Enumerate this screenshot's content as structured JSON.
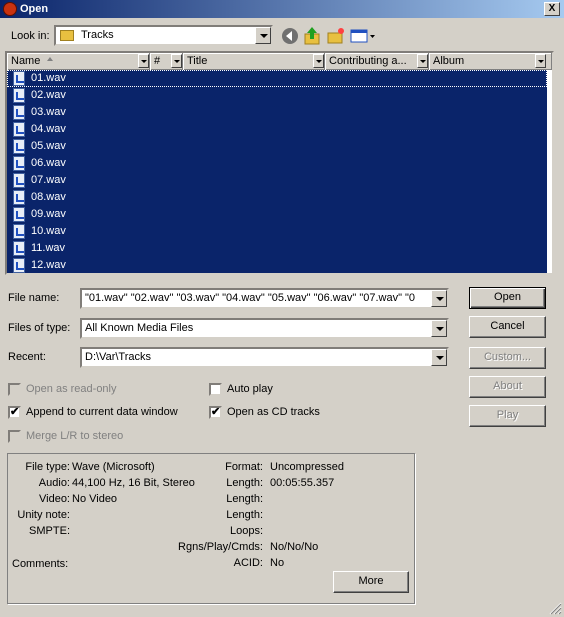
{
  "window": {
    "title": "Open",
    "close": "X"
  },
  "lookin": {
    "label": "Look in:",
    "value": "Tracks"
  },
  "columns": [
    "Name",
    "#",
    "Title",
    "Contributing a...",
    "Album"
  ],
  "files": [
    "01.wav",
    "02.wav",
    "03.wav",
    "04.wav",
    "05.wav",
    "06.wav",
    "07.wav",
    "08.wav",
    "09.wav",
    "10.wav",
    "11.wav",
    "12.wav"
  ],
  "filename": {
    "label": "File name:",
    "value": "\"01.wav\" \"02.wav\" \"03.wav\" \"04.wav\" \"05.wav\" \"06.wav\" \"07.wav\" \"0"
  },
  "filetype": {
    "label": "Files of type:",
    "value": "All Known Media Files"
  },
  "recent": {
    "label": "Recent:",
    "value": "D:\\Var\\Tracks"
  },
  "buttons": {
    "open": "Open",
    "cancel": "Cancel",
    "custom": "Custom...",
    "about": "About",
    "play": "Play",
    "more": "More"
  },
  "checks": {
    "readonly": {
      "label": "Open as read-only",
      "checked": false,
      "enabled": false
    },
    "append": {
      "label": "Append to current data window",
      "checked": true,
      "enabled": true
    },
    "merge": {
      "label": "Merge L/R to stereo",
      "checked": false,
      "enabled": false
    },
    "autoplay": {
      "label": "Auto play",
      "checked": false,
      "enabled": true
    },
    "cdtracks": {
      "label": "Open as CD tracks",
      "checked": true,
      "enabled": true
    }
  },
  "checkmark": "✔",
  "info": {
    "filetype_label": "File type:",
    "filetype": "Wave (Microsoft)",
    "audio_label": "Audio:",
    "audio": "44,100 Hz, 16 Bit, Stereo",
    "video_label": "Video:",
    "video": "No Video",
    "unity_label": "Unity note:",
    "unity": "",
    "smpte_label": "SMPTE:",
    "smpte": "",
    "comments_label": "Comments:",
    "comments": "",
    "format_label": "Format:",
    "format": "Uncompressed",
    "length1_label": "Length:",
    "length1": "00:05:55.357",
    "length2_label": "Length:",
    "length2": "",
    "length3_label": "Length:",
    "length3": "",
    "loops_label": "Loops:",
    "loops": "",
    "rgns_label": "Rgns/Play/Cmds:",
    "rgns": "No/No/No",
    "acid_label": "ACID:",
    "acid": "No"
  }
}
